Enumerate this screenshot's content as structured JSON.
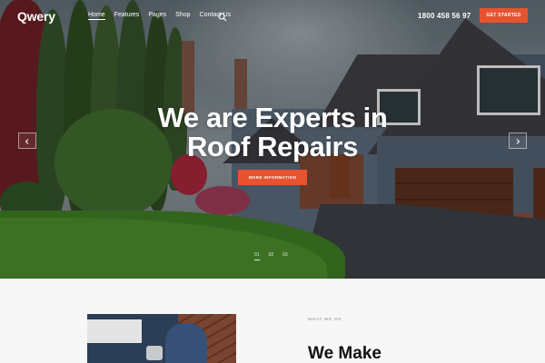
{
  "brand": {
    "name": "Qwery"
  },
  "nav": {
    "items": [
      {
        "label": "Home",
        "active": true
      },
      {
        "label": "Features",
        "active": false
      },
      {
        "label": "Pages",
        "active": false
      },
      {
        "label": "Shop",
        "active": false
      },
      {
        "label": "Contact Us",
        "active": false
      }
    ],
    "search_icon": "search-icon"
  },
  "header": {
    "phone": "1800 458 56 97",
    "cta_label": "GET STARTED"
  },
  "hero": {
    "headline_line1": "We are Experts in",
    "headline_line2": "Roof Repairs",
    "button_label": "MORE INFORMATION",
    "prev_icon": "arrow-left-icon",
    "next_icon": "arrow-right-icon",
    "slides": [
      "01",
      "02",
      "03"
    ],
    "active_slide": 0
  },
  "section": {
    "eyebrow": "WHAT WE DO",
    "heading": "We Make"
  },
  "colors": {
    "accent": "#e8532f",
    "white": "#ffffff",
    "section_bg": "#f7f7f8"
  }
}
